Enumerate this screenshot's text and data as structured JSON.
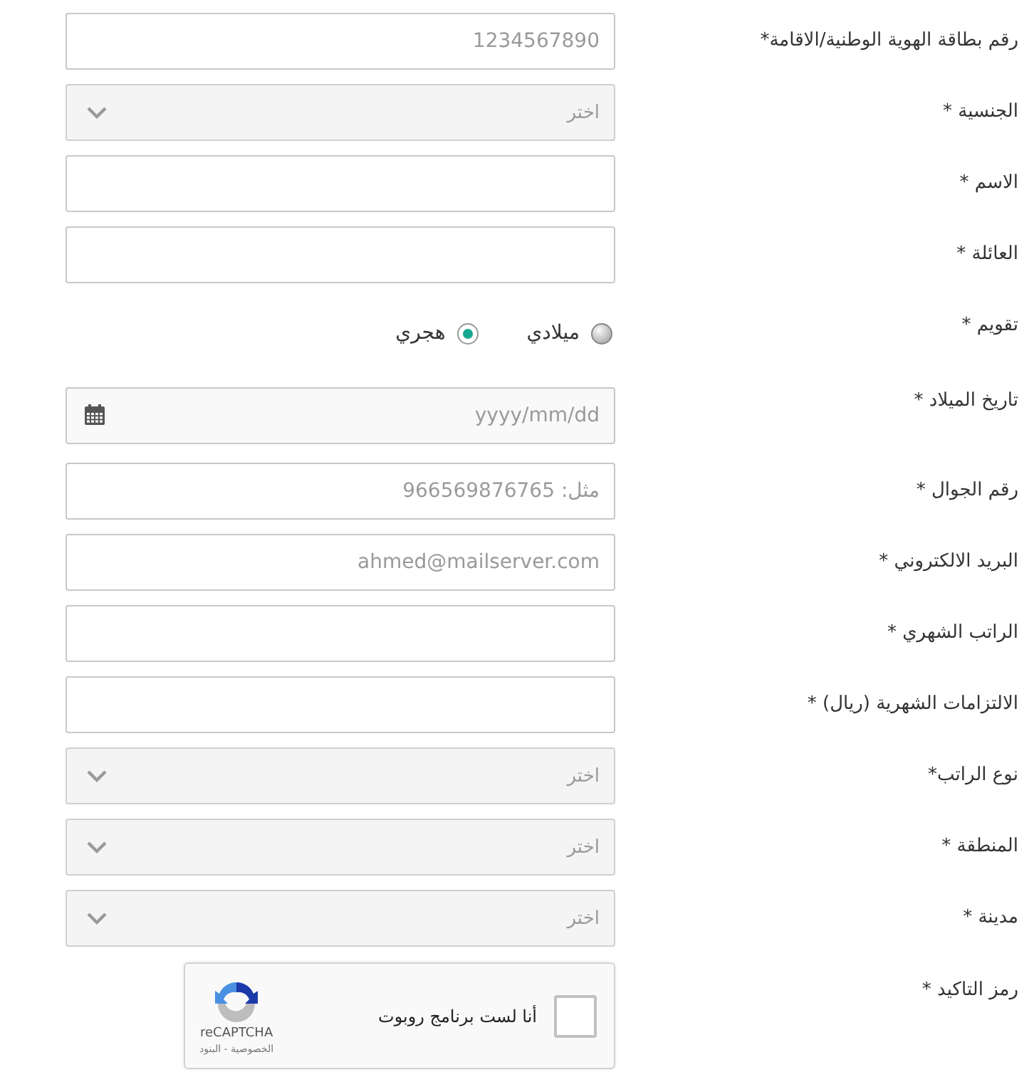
{
  "fields": [
    {
      "kind": "text",
      "label": "رقم بطاقة الهوية الوطنية/الاقامة*",
      "placeholder": "1234567890"
    },
    {
      "kind": "select",
      "label": "الجنسية *",
      "placeholder": "اختر"
    },
    {
      "kind": "text",
      "label": "الاسم *"
    },
    {
      "kind": "text",
      "label": "العائلة *"
    },
    {
      "kind": "radio",
      "label": "تقويم *",
      "options": [
        {
          "label": "ميلادي",
          "selected": false
        },
        {
          "label": "هجري",
          "selected": true
        }
      ]
    },
    {
      "kind": "date",
      "label": "تاريخ الميلاد *",
      "placeholder": "yyyy/mm/dd"
    },
    {
      "kind": "text",
      "label": "رقم الجوال *",
      "placeholder": "مثل: 966569876765"
    },
    {
      "kind": "text",
      "label": "البريد الالكتروني *",
      "placeholder": "ahmed@mailserver.com"
    },
    {
      "kind": "text",
      "label": "الراتب الشهري *"
    },
    {
      "kind": "text",
      "label": "الالتزامات الشهرية (ريال) *"
    },
    {
      "kind": "select",
      "label": "نوع الراتب*",
      "placeholder": "اختر"
    },
    {
      "kind": "select",
      "label": "المنطقة *",
      "placeholder": "اختر"
    },
    {
      "kind": "select",
      "label": "مدينة *",
      "placeholder": "اختر"
    },
    {
      "kind": "captcha",
      "label": "رمز التاكيد *",
      "checkbox_label": "أنا لست برنامج روبوت",
      "checked": false,
      "brand": "reCAPTCHA",
      "links": "الخصوصية - البنود"
    }
  ]
}
